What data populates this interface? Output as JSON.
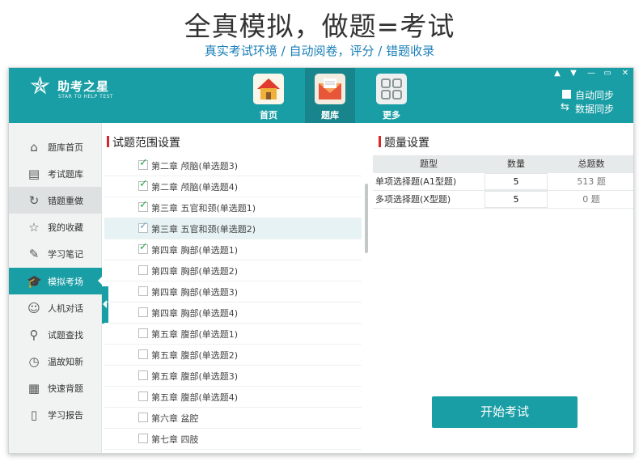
{
  "hero": {
    "title": "全真模拟，做题=考试",
    "subtitle": "真实考试环境 / 自动阅卷，评分 / 错题收录"
  },
  "app": {
    "logo_name": "助考之星",
    "logo_en": "STAR TO HELP TEST",
    "nav": [
      {
        "label": "首页",
        "icon": "home-icon"
      },
      {
        "label": "题库",
        "icon": "envelope-icon"
      },
      {
        "label": "更多",
        "icon": "grid-icon"
      }
    ],
    "auto_sync": "自动同步",
    "data_sync": "数据同步",
    "window_controls": [
      "pin-icon",
      "dropdown-icon",
      "minimize-icon",
      "maximize-icon",
      "close-icon"
    ]
  },
  "sidebar": {
    "items": [
      {
        "label": "题库首页",
        "glyph": "⌂"
      },
      {
        "label": "考试题库",
        "glyph": "▤"
      },
      {
        "label": "错题重做",
        "glyph": "↻"
      },
      {
        "label": "我的收藏",
        "glyph": "☆"
      },
      {
        "label": "学习笔记",
        "glyph": "✎"
      },
      {
        "label": "模拟考场",
        "glyph": "🎓"
      },
      {
        "label": "人机对话",
        "glyph": "☺"
      },
      {
        "label": "试题查找",
        "glyph": "⚲"
      },
      {
        "label": "温故知新",
        "glyph": "◷"
      },
      {
        "label": "快速背题",
        "glyph": "▦"
      },
      {
        "label": "学习报告",
        "glyph": "▯"
      }
    ]
  },
  "scope": {
    "title": "试题范围设置",
    "chapters": [
      {
        "label": "第二章 颅脑(单选题3)",
        "checked": true
      },
      {
        "label": "第二章 颅脑(单选题4)",
        "checked": true
      },
      {
        "label": "第三章 五官和颈(单选题1)",
        "checked": true
      },
      {
        "label": "第三章 五官和颈(单选题2)",
        "checked": true
      },
      {
        "label": "第四章 胸部(单选题1)",
        "checked": true
      },
      {
        "label": "第四章 胸部(单选题2)",
        "checked": false
      },
      {
        "label": "第四章 胸部(单选题3)",
        "checked": false
      },
      {
        "label": "第四章 胸部(单选题4)",
        "checked": false
      },
      {
        "label": "第五章 腹部(单选题1)",
        "checked": false
      },
      {
        "label": "第五章 腹部(单选题2)",
        "checked": false
      },
      {
        "label": "第五章 腹部(单选题3)",
        "checked": false
      },
      {
        "label": "第五章 腹部(单选题4)",
        "checked": false
      },
      {
        "label": "第六章 盆腔",
        "checked": false
      },
      {
        "label": "第七章 四肢",
        "checked": false
      }
    ]
  },
  "quantity": {
    "title": "题量设置",
    "headers": [
      "题型",
      "数量",
      "总题数"
    ],
    "rows": [
      {
        "type": "单项选择题(A1型题)",
        "count": "5",
        "total": "513 题"
      },
      {
        "type": "多项选择题(X型题)",
        "count": "5",
        "total": "0 题"
      }
    ]
  },
  "start_button": "开始考试",
  "colors": {
    "accent": "#1a9ea5",
    "marker": "#d9262c",
    "check": "#2aa548"
  }
}
